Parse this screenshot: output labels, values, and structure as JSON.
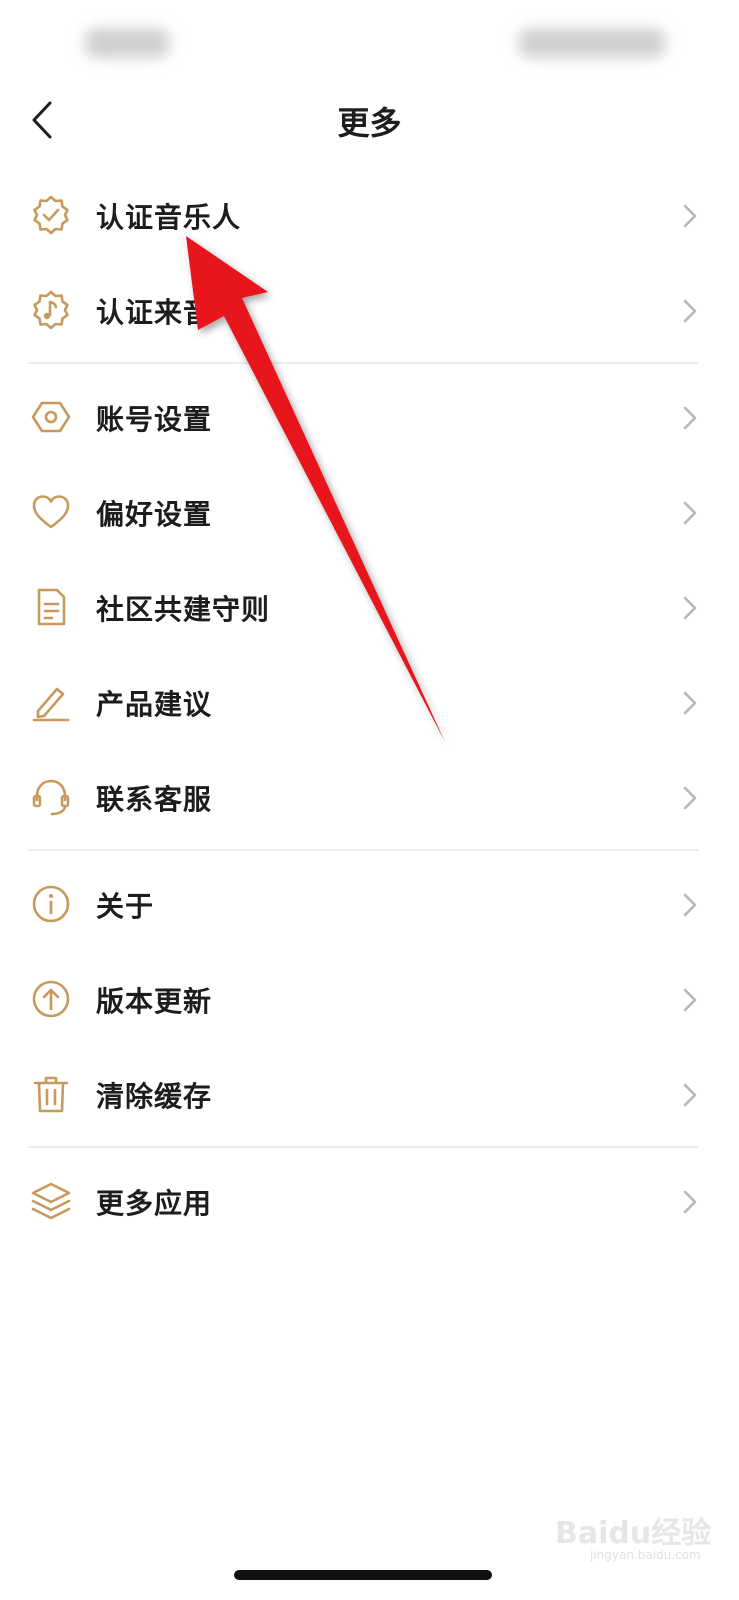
{
  "header": {
    "title": "更多",
    "back_icon": "chevron-left-icon"
  },
  "menu": {
    "items": [
      {
        "label": "认证音乐人",
        "icon": "verified-badge-icon"
      },
      {
        "label": "认证来音",
        "icon": "music-badge-icon"
      },
      {
        "label": "账号设置",
        "icon": "hexagon-settings-icon"
      },
      {
        "label": "偏好设置",
        "icon": "heart-icon"
      },
      {
        "label": "社区共建守则",
        "icon": "document-icon"
      },
      {
        "label": "产品建议",
        "icon": "pen-icon"
      },
      {
        "label": "联系客服",
        "icon": "headset-icon"
      },
      {
        "label": "关于",
        "icon": "info-icon"
      },
      {
        "label": "版本更新",
        "icon": "upload-circle-icon"
      },
      {
        "label": "清除缓存",
        "icon": "trash-icon"
      },
      {
        "label": "更多应用",
        "icon": "layers-icon"
      }
    ]
  },
  "annotation": {
    "color": "#e8141b"
  },
  "watermark": {
    "text": "Baidu经验",
    "sub": "jingyan.baidu.com"
  },
  "colors": {
    "icon_gold": "#c79a5c",
    "chevron": "#b7b7b7",
    "text": "#1d1d1d",
    "divider": "#ececec"
  }
}
